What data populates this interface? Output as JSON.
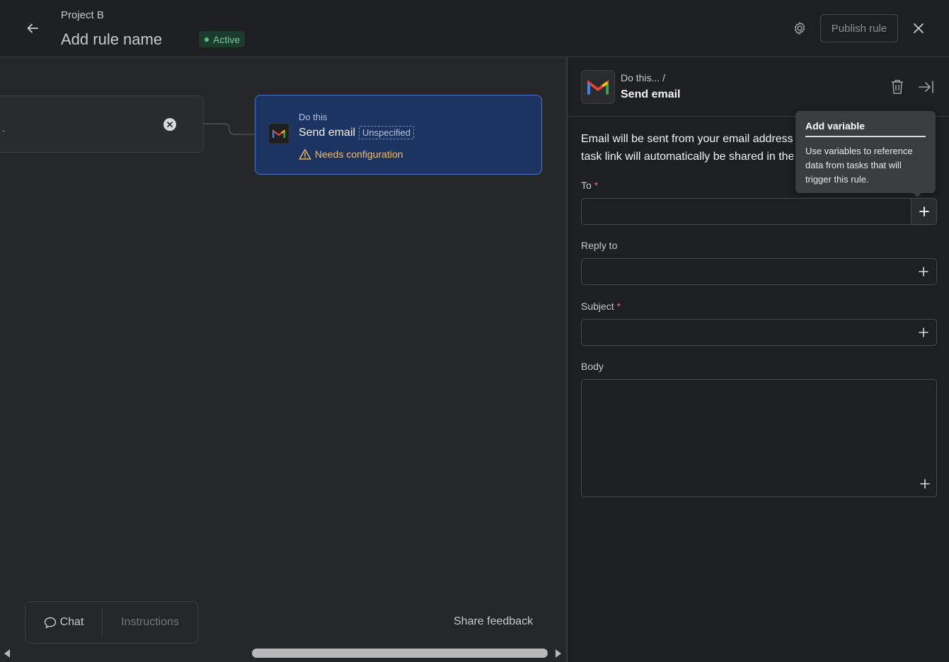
{
  "header": {
    "project_name": "Project B",
    "rule_name": "Add rule name",
    "status": "Active",
    "publish_label": "Publish rule"
  },
  "canvas": {
    "trigger_text": ".",
    "action_card": {
      "small_label": "Do this",
      "title": "Send email",
      "unspecified": "Unspecified",
      "warning": "Needs configuration"
    },
    "bottom_bar": {
      "chat_label": "Chat",
      "instructions_label": "Instructions"
    },
    "share_feedback": "Share feedback"
  },
  "panel": {
    "breadcrumb": "Do this...  /",
    "title": "Send email",
    "description_line1": "Email will be sent from your email address b",
    "description_line2": "task link will automatically be shared in the e",
    "fields": {
      "to_label": "To",
      "reply_to_label": "Reply to",
      "subject_label": "Subject",
      "body_label": "Body",
      "required_mark": "*"
    }
  },
  "tooltip": {
    "title": "Add variable",
    "body": "Use variables to reference data from tasks that will trigger this rule."
  },
  "colors": {
    "accent_blue": "#4a73c7",
    "card_blue": "#1b3461",
    "warning": "#f1bd6c",
    "active_green": "#58c08a",
    "required_red": "#e8686b"
  }
}
